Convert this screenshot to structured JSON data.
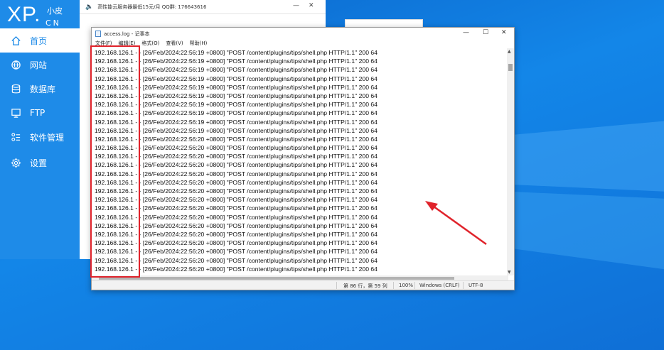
{
  "app": {
    "logo_xp": "XP.",
    "logo_cn_top": "小皮",
    "logo_cn_bottom": "CN",
    "topbar_text": "高性能云服务器最低15元/月  QQ群: 176643616",
    "nav": [
      {
        "label": "首页",
        "icon": "home-icon",
        "active": true
      },
      {
        "label": "网站",
        "icon": "globe-icon",
        "active": false
      },
      {
        "label": "数据库",
        "icon": "database-icon",
        "active": false
      },
      {
        "label": "FTP",
        "icon": "monitor-icon",
        "active": false
      },
      {
        "label": "软件管理",
        "icon": "grid-icon",
        "active": false
      },
      {
        "label": "设置",
        "icon": "gear-icon",
        "active": false
      }
    ]
  },
  "notepad": {
    "title": "access.log - 记事本",
    "menu": [
      "文件(F)",
      "编辑(E)",
      "格式(O)",
      "查看(V)",
      "帮助(H)"
    ],
    "lines": [
      "192.168.126.1 - - [26/Feb/2024:22:56:19 +0800] \"POST /content/plugins/tips/shell.php HTTP/1.1\" 200 64",
      "192.168.126.1 - - [26/Feb/2024:22:56:19 +0800] \"POST /content/plugins/tips/shell.php HTTP/1.1\" 200 64",
      "192.168.126.1 - - [26/Feb/2024:22:56:19 +0800] \"POST /content/plugins/tips/shell.php HTTP/1.1\" 200 64",
      "192.168.126.1 - - [26/Feb/2024:22:56:19 +0800] \"POST /content/plugins/tips/shell.php HTTP/1.1\" 200 64",
      "192.168.126.1 - - [26/Feb/2024:22:56:19 +0800] \"POST /content/plugins/tips/shell.php HTTP/1.1\" 200 64",
      "192.168.126.1 - - [26/Feb/2024:22:56:19 +0800] \"POST /content/plugins/tips/shell.php HTTP/1.1\" 200 64",
      "192.168.126.1 - - [26/Feb/2024:22:56:19 +0800] \"POST /content/plugins/tips/shell.php HTTP/1.1\" 200 64",
      "192.168.126.1 - - [26/Feb/2024:22:56:19 +0800] \"POST /content/plugins/tips/shell.php HTTP/1.1\" 200 64",
      "192.168.126.1 - - [26/Feb/2024:22:56:19 +0800] \"POST /content/plugins/tips/shell.php HTTP/1.1\" 200 64",
      "192.168.126.1 - - [26/Feb/2024:22:56:19 +0800] \"POST /content/plugins/tips/shell.php HTTP/1.1\" 200 64",
      "192.168.126.1 - - [26/Feb/2024:22:56:20 +0800] \"POST /content/plugins/tips/shell.php HTTP/1.1\" 200 64",
      "192.168.126.1 - - [26/Feb/2024:22:56:20 +0800] \"POST /content/plugins/tips/shell.php HTTP/1.1\" 200 64",
      "192.168.126.1 - - [26/Feb/2024:22:56:20 +0800] \"POST /content/plugins/tips/shell.php HTTP/1.1\" 200 64",
      "192.168.126.1 - - [26/Feb/2024:22:56:20 +0800] \"POST /content/plugins/tips/shell.php HTTP/1.1\" 200 64",
      "192.168.126.1 - - [26/Feb/2024:22:56:20 +0800] \"POST /content/plugins/tips/shell.php HTTP/1.1\" 200 64",
      "192.168.126.1 - - [26/Feb/2024:22:56:20 +0800] \"POST /content/plugins/tips/shell.php HTTP/1.1\" 200 64",
      "192.168.126.1 - - [26/Feb/2024:22:56:20 +0800] \"POST /content/plugins/tips/shell.php HTTP/1.1\" 200 64",
      "192.168.126.1 - - [26/Feb/2024:22:56:20 +0800] \"POST /content/plugins/tips/shell.php HTTP/1.1\" 200 64",
      "192.168.126.1 - - [26/Feb/2024:22:56:20 +0800] \"POST /content/plugins/tips/shell.php HTTP/1.1\" 200 64",
      "192.168.126.1 - - [26/Feb/2024:22:56:20 +0800] \"POST /content/plugins/tips/shell.php HTTP/1.1\" 200 64",
      "192.168.126.1 - - [26/Feb/2024:22:56:20 +0800] \"POST /content/plugins/tips/shell.php HTTP/1.1\" 200 64",
      "192.168.126.1 - - [26/Feb/2024:22:56:20 +0800] \"POST /content/plugins/tips/shell.php HTTP/1.1\" 200 64",
      "192.168.126.1 - - [26/Feb/2024:22:56:20 +0800] \"POST /content/plugins/tips/shell.php HTTP/1.1\" 200 64",
      "192.168.126.1 - - [26/Feb/2024:22:56:20 +0800] \"POST /content/plugins/tips/shell.php HTTP/1.1\" 200 64",
      "192.168.126.1 - - [26/Feb/2024:22:56:20 +0800] \"POST /content/plugins/tips/shell.php HTTP/1.1\" 200 64",
      "192.168.126.1 - - [26/Feb/2024:22:56:20 +0800] \"POST /content/plugins/tips/shell.php HTTP/1.1\" 200 64"
    ],
    "status": {
      "position": "第 86 行，第 59 列",
      "zoom": "100%",
      "line_ending": "Windows (CRLF)",
      "encoding": "UTF-8"
    }
  },
  "colors": {
    "sidebar": "#1e8be8",
    "highlight": "#e0232b",
    "desktop": "#0f6fd6"
  }
}
